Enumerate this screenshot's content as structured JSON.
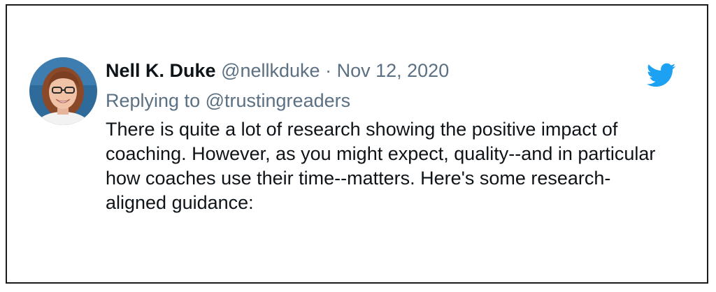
{
  "tweet": {
    "author_name": "Nell K. Duke",
    "author_handle": "@nellkduke",
    "separator": "·",
    "date": "Nov 12, 2020",
    "replying_prefix": "Replying to",
    "replying_handle": "@trustingreaders",
    "text": "There is quite a lot of research showing the positive impact of coaching. However, as you might expect, quality--and in particular how coaches use their time--matters. Here's some research-aligned guidance:",
    "avatar_icon": "avatar",
    "platform_icon": "twitter-bird-icon"
  },
  "colors": {
    "name": "#0f1419",
    "meta": "#5b7083",
    "twitter_blue": "#1da1f2",
    "border": "#1a1a1a"
  }
}
